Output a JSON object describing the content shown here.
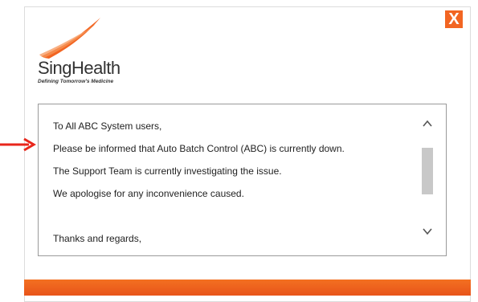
{
  "dialog": {
    "close_label": "X",
    "close_icon": "close-icon"
  },
  "logo": {
    "name": "SingHealth",
    "tagline": "Defining Tomorrow's Medicine",
    "icon": "singhealth-swoosh-icon"
  },
  "annotation": {
    "icon": "arrow-right-icon",
    "color": "#e8261b"
  },
  "message": {
    "lines": [
      "To All ABC System users,",
      "Please be informed that Auto Batch Control (ABC) is currently down.",
      "The Support Team is currently investigating the issue.",
      "We apologise for any inconvenience caused.",
      "",
      "Thanks and regards,"
    ]
  },
  "scrollbar": {
    "up_icon": "chevron-up-icon",
    "down_icon": "chevron-down-icon"
  },
  "colors": {
    "accent": "#f26522",
    "footer": "#f37021"
  }
}
